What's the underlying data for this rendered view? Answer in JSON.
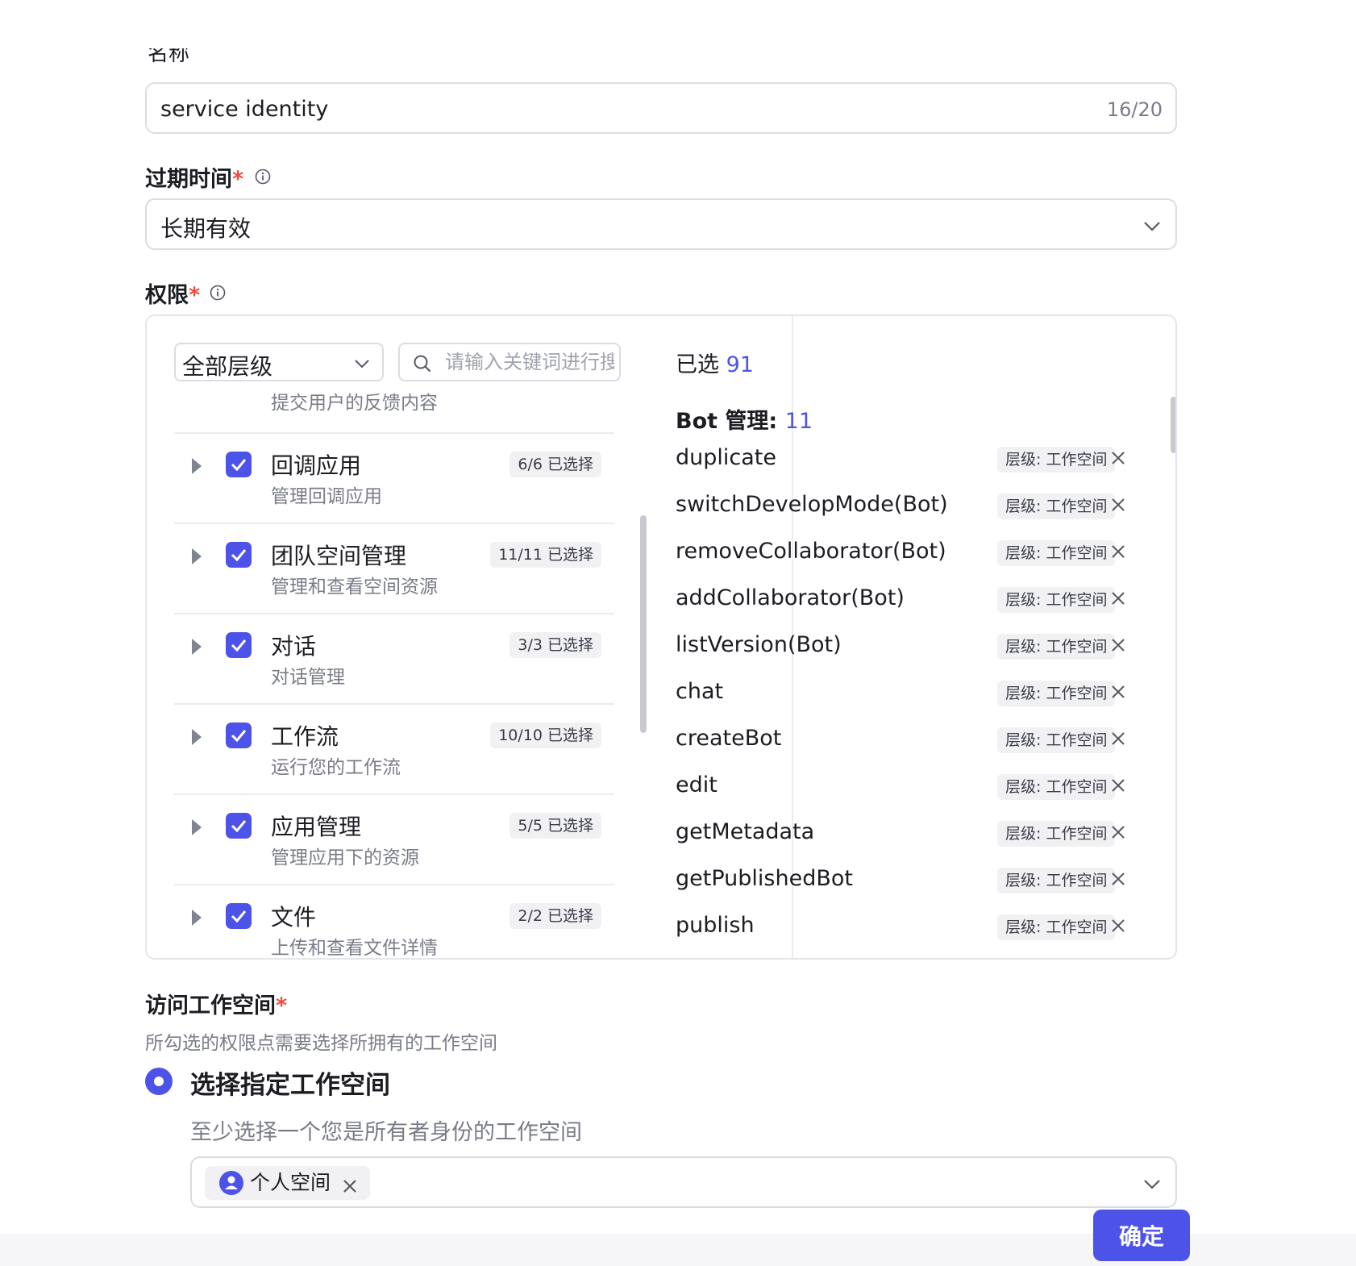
{
  "form": {
    "name_label": "名称",
    "name_value": "service identity",
    "name_count": "16/20",
    "expire_label": "过期时间",
    "expire_value": "长期有效",
    "perm_label": "权限",
    "required_mark": "*"
  },
  "permissions": {
    "level_select": "全部层级",
    "search_placeholder": "请输入关键词进行搜索",
    "prev_desc": "提交用户的反馈内容",
    "rows": [
      {
        "title": "回调应用",
        "desc": "管理回调应用",
        "count": "6/6 已选择"
      },
      {
        "title": "团队空间管理",
        "desc": "管理和查看空间资源",
        "count": "11/11 已选择"
      },
      {
        "title": "对话",
        "desc": "对话管理",
        "count": "3/3 已选择"
      },
      {
        "title": "工作流",
        "desc": "运行您的工作流",
        "count": "10/10 已选择"
      },
      {
        "title": "应用管理",
        "desc": "管理应用下的资源",
        "count": "5/5 已选择"
      },
      {
        "title": "文件",
        "desc": "上传和查看文件详情",
        "count": "2/2 已选择"
      }
    ],
    "selected_label": "已选",
    "selected_count": "91",
    "group_label": "Bot 管理:",
    "group_count": "11",
    "level_tag": "层级: 工作空间",
    "selected_items": [
      "duplicate",
      "switchDevelopMode(Bot)",
      "removeCollaborator(Bot)",
      "addCollaborator(Bot)",
      "listVersion(Bot)",
      "chat",
      "createBot",
      "edit",
      "getMetadata",
      "getPublishedBot",
      "publish"
    ]
  },
  "workspace": {
    "label": "访问工作空间",
    "sub": "所勾选的权限点需要选择所拥有的工作空间",
    "radio_label": "选择指定工作空间",
    "radio_help": "至少选择一个您是所有者身份的工作空间",
    "tag": "个人空间"
  },
  "confirm_label": "确定",
  "colors": {
    "accent": "#4d53e8",
    "required": "#f0493d",
    "muted": "#7a7d88"
  }
}
